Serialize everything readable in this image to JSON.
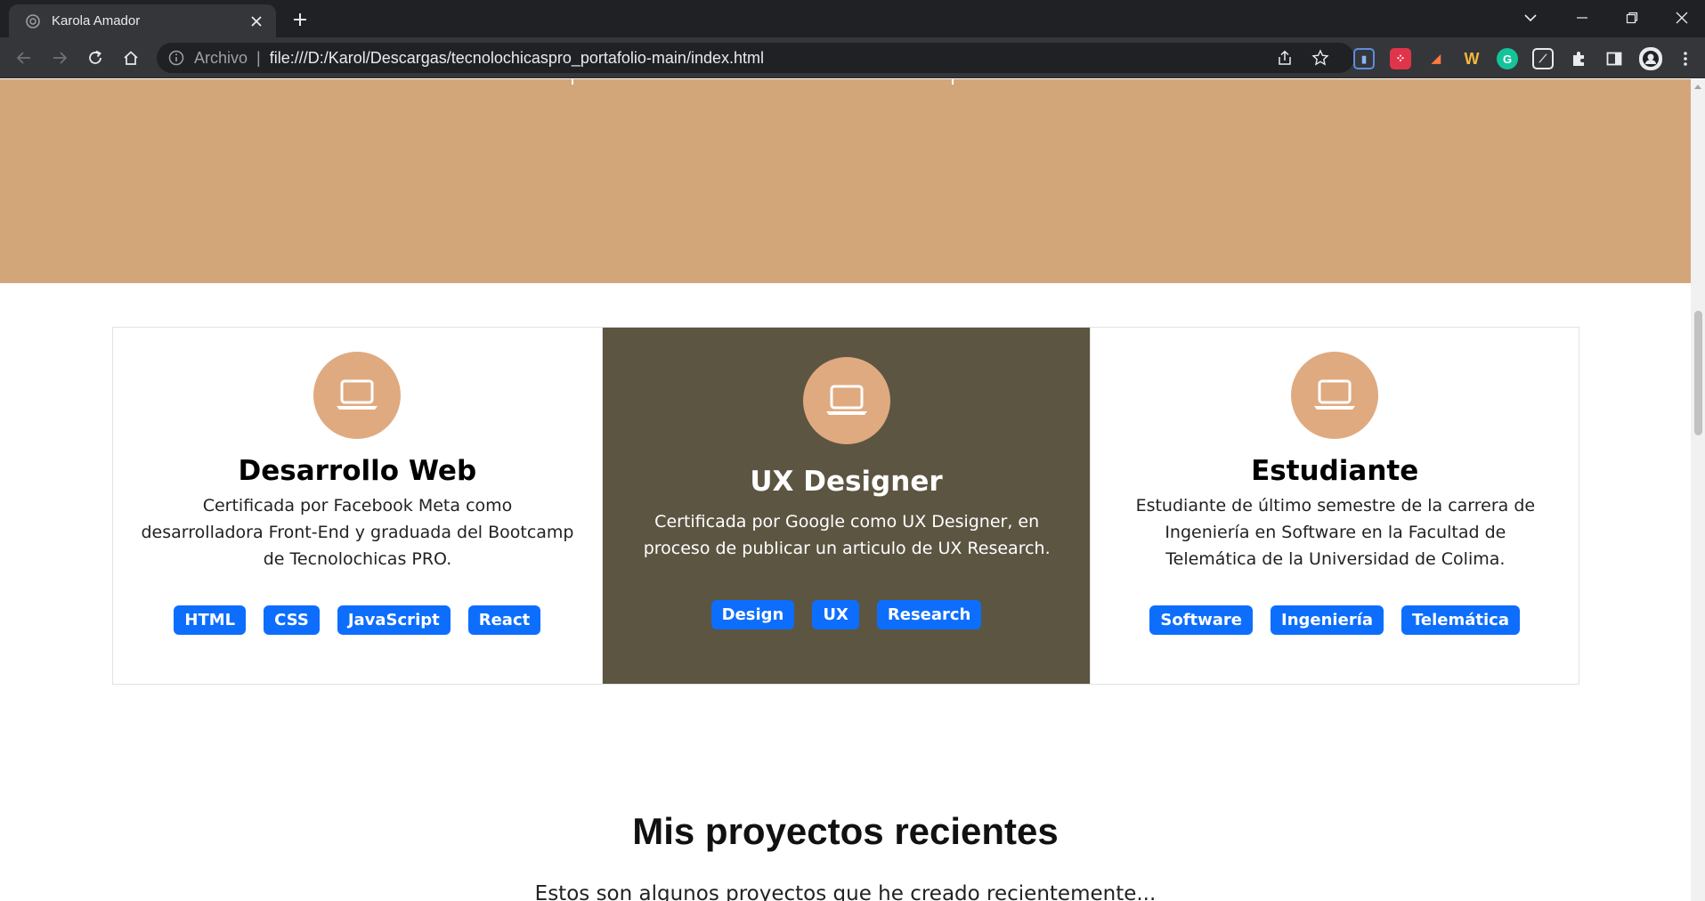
{
  "browser": {
    "tab_title": "Karola Amador",
    "address_scheme": "Archivo",
    "address_url": "file:///D:/Karol/Descargas/tecnolochicaspro_portafolio-main/index.html"
  },
  "services": [
    {
      "title": "Desarrollo Web",
      "description": "Certificada por Facebook Meta como desarrolladora Front-End y graduada del Bootcamp de Tecnolochicas PRO.",
      "tags": [
        "HTML",
        "CSS",
        "JavaScript",
        "React"
      ],
      "highlighted": false
    },
    {
      "title": "UX Designer",
      "description": "Certificada por Google como UX Designer, en proceso de publicar un articulo de UX Research.",
      "tags": [
        "Design",
        "UX",
        "Research"
      ],
      "highlighted": true
    },
    {
      "title": "Estudiante",
      "description": "Estudiante de último semestre de la carrera de Ingeniería en Software en la Facultad de Telemática de la Universidad de Colima.",
      "tags": [
        "Software",
        "Ingeniería",
        "Telemática"
      ],
      "highlighted": false
    }
  ],
  "projects": {
    "title": "Mis proyectos recientes",
    "subtitle": "Estos son algunos proyectos que he creado recientemente..."
  },
  "colors": {
    "hero_bg": "#d3a679",
    "card_highlight_bg": "#5c5542",
    "icon_circle": "#dfaa80",
    "tag_bg": "#0d6efd"
  }
}
